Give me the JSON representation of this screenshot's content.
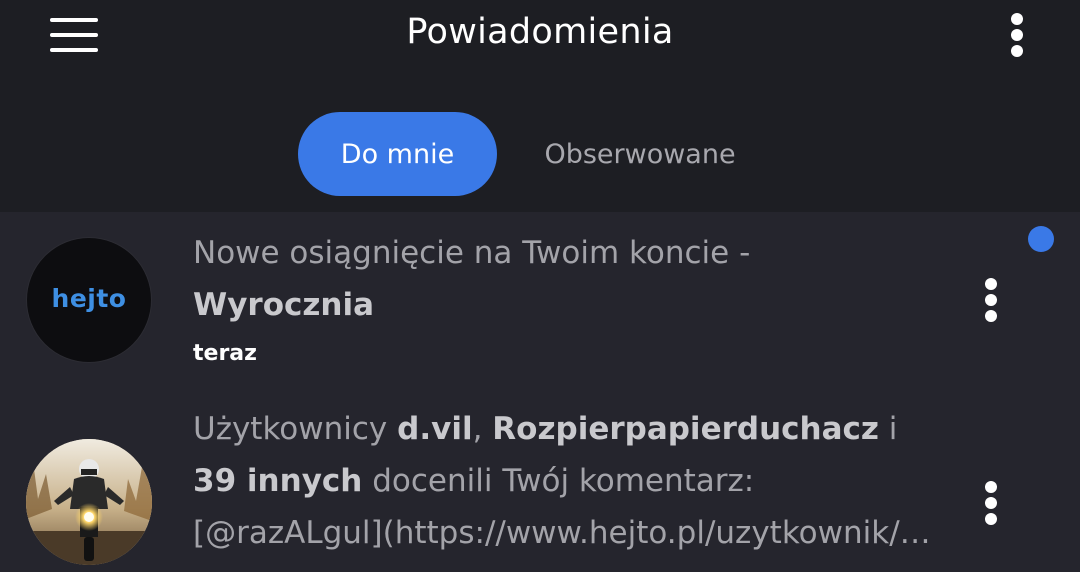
{
  "header": {
    "title": "Powiadomienia",
    "menu_icon": "hamburger-menu-icon",
    "more_icon": "more-vertical-icon"
  },
  "tabs": [
    {
      "label": "Do mnie",
      "active": true
    },
    {
      "label": "Obserwowane",
      "active": false
    }
  ],
  "notifications": [
    {
      "avatar_logo_text": "hejto",
      "text": "Nowe osiągnięcie na Twoim koncie - ",
      "bold": "Wyrocznia",
      "time": "teraz",
      "unread": true
    },
    {
      "prefix": "Użytkownicy ",
      "user1": "d.vil",
      "sep": ", ",
      "user2": "Rozpierpapierduchacz",
      "and": " i",
      "others": "39 innych",
      "action": " docenili Twój komentarz:",
      "preview": "[@razALgul](https://www.hejto.pl/uzytkownik/razALgul)",
      "avatar_icon": "motorcycle-rider-avatar"
    }
  ],
  "colors": {
    "accent": "#3a79e7",
    "header_bg": "#1d1e23",
    "list_bg": "#25252d",
    "muted_text": "#a3a3a9"
  }
}
